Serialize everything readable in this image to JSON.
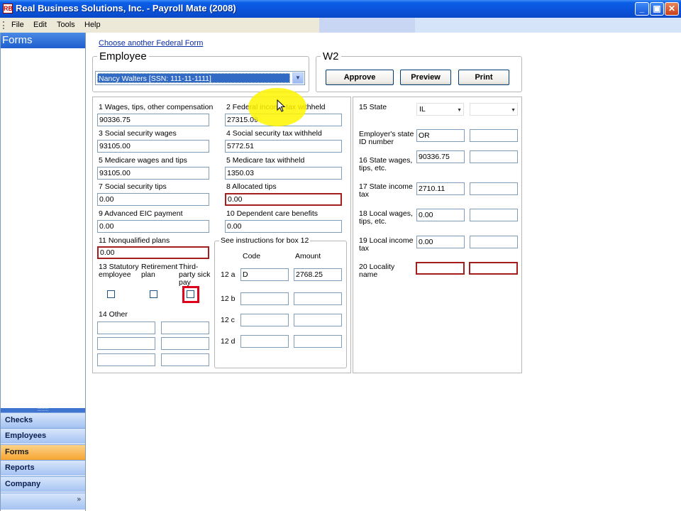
{
  "window": {
    "title": "Real Business Solutions, Inc. - Payroll Mate (2008)",
    "app_icon": "RB",
    "min_glyph": "_",
    "max_glyph": "▣",
    "close_glyph": "✕"
  },
  "menu": [
    "File",
    "Edit",
    "Tools",
    "Help"
  ],
  "sidebar": {
    "header": "Forms",
    "splitter": "::::::::",
    "items": [
      "Checks",
      "Employees",
      "Forms",
      "Reports",
      "Company"
    ],
    "active": "Forms",
    "more_glyph": "»"
  },
  "main": {
    "choose_link": "Choose another Federal Form",
    "employee_group": "Employee",
    "employee_selected": "Nancy Walters [SSN: 111-11-1111]",
    "combo_arrow": "▼",
    "w2_group": "W2",
    "buttons": {
      "approve": "Approve",
      "preview": "Preview",
      "print": "Print"
    },
    "boxes": {
      "b1_label": "1 Wages, tips, other compensation",
      "b1_value": "90336.75",
      "b2_label": "2 Federal income tax withheld",
      "b2_value": "27315.09",
      "b3_label": "3 Social security wages",
      "b3_value": "93105.00",
      "b4_label": "4 Social security tax withheld",
      "b4_value": "5772.51",
      "b5_label": "5 Medicare wages and tips",
      "b5_value": "93105.00",
      "b6_label": "5 Medicare tax withheld",
      "b6_value": "1350.03",
      "b7_label": "7 Social security tips",
      "b7_value": "0.00",
      "b8_label": "8 Allocated tips",
      "b8_value": "0.00",
      "b9_label": "9 Advanced EIC payment",
      "b9_value": "0.00",
      "b10_label": "10 Dependent care benefits",
      "b10_value": "0.00",
      "b11_label": "11 Nonqualified plans",
      "b11_value": "0.00",
      "b13_statutory": "13 Statutory employee",
      "b13_retirement": "Retirement plan",
      "b13_sick": "Third-party sick pay",
      "b14_label": "14 Other"
    },
    "box12": {
      "title": "See instructions for box 12",
      "code_header": "Code",
      "amount_header": "Amount",
      "rows": [
        {
          "label": "12 a",
          "code": "D",
          "amount": "2768.25"
        },
        {
          "label": "12 b",
          "code": "",
          "amount": ""
        },
        {
          "label": "12 c",
          "code": "",
          "amount": ""
        },
        {
          "label": "12 d",
          "code": "",
          "amount": ""
        }
      ]
    },
    "state": {
      "b15_label": "15 State",
      "state_value": "IL",
      "combo_arrow": "▼",
      "employer_id_label": "Employer's state ID number",
      "employer_id_value": "OR",
      "b16_label": "16 State wages, tips, etc.",
      "b16_value": "90336.75",
      "b17_label": "17 State income tax",
      "b17_value": "2710.11",
      "b18_label": "18 Local wages, tips, etc.",
      "b18_value": "0.00",
      "b19_label": "19 Local income tax",
      "b19_value": "0.00",
      "b20_label": "20 Locality name"
    }
  }
}
